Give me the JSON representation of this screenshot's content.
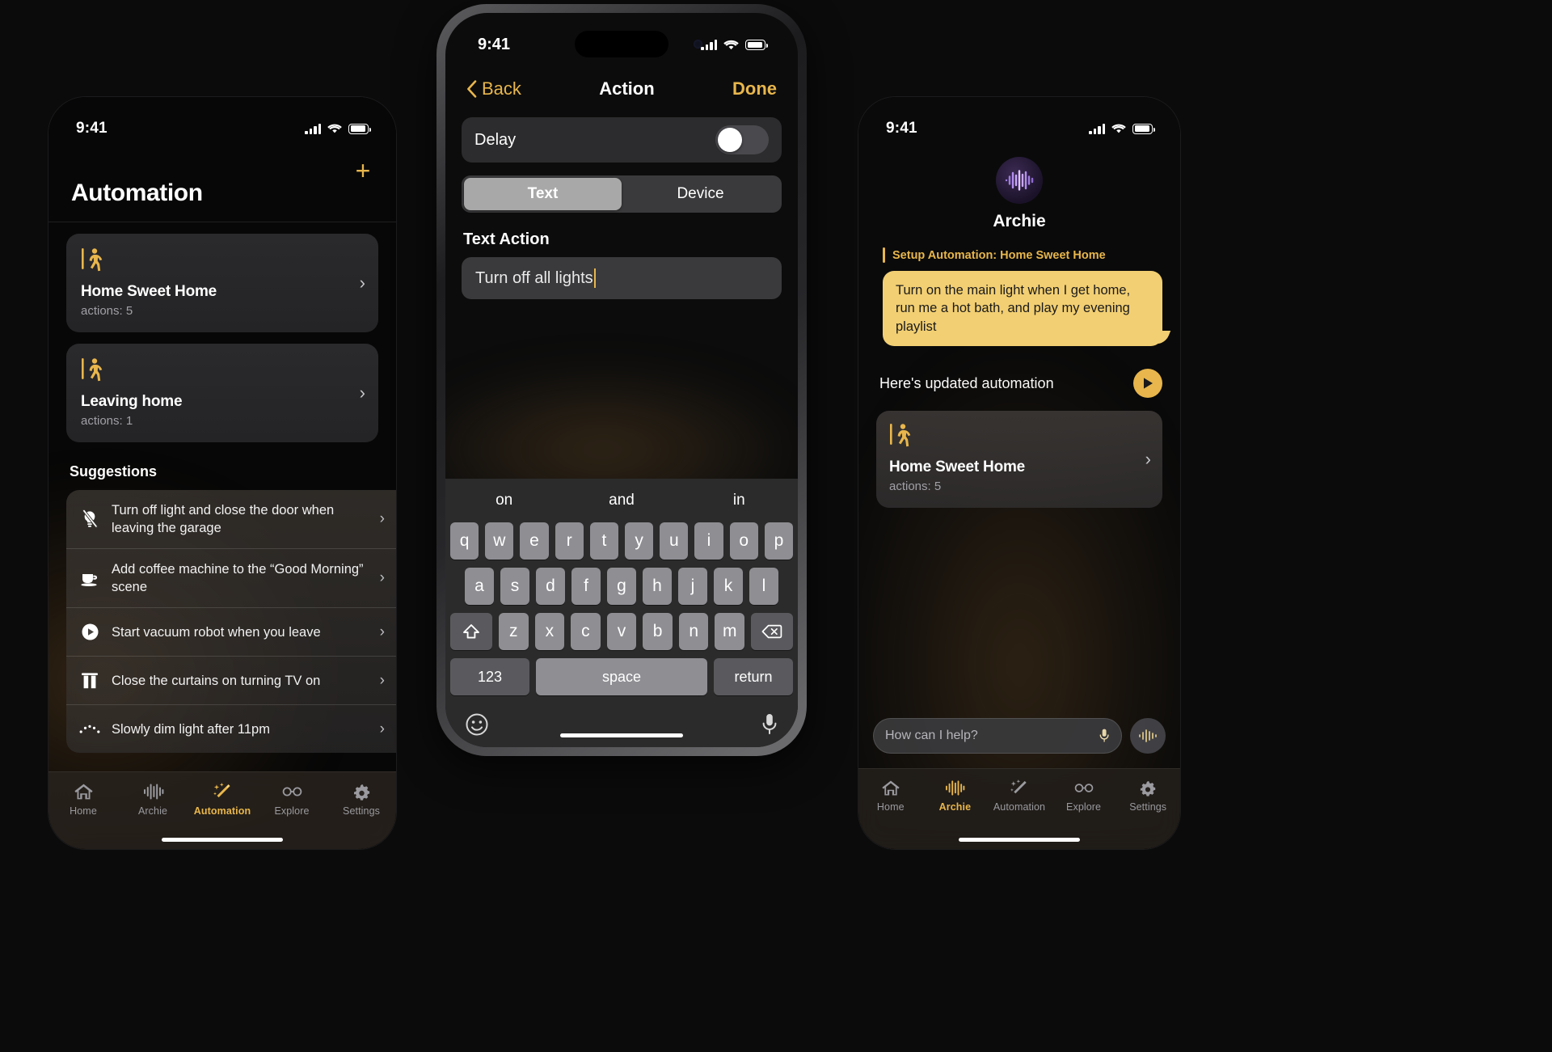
{
  "left_phone": {
    "status": {
      "time": "9:41",
      "cellular_icon": "cellular-bars-icon",
      "wifi_icon": "wifi-icon",
      "battery_icon": "battery-icon"
    },
    "add_label": "+",
    "title": "Automation",
    "automations": [
      {
        "icon": "person-walking-door-icon",
        "title": "Home Sweet Home",
        "subtitle": "actions: 5",
        "chevron": "›"
      },
      {
        "icon": "person-walking-door-icon",
        "title": "Leaving home",
        "subtitle": "actions: 1",
        "chevron": "›"
      }
    ],
    "suggestions_header": "Suggestions",
    "suggestions": [
      {
        "icon": "lightbulb-slash-icon",
        "text": "Turn off light and close the door when leaving the garage",
        "chevron": "›"
      },
      {
        "icon": "coffee-cup-icon",
        "text": "Add coffee machine to the “Good Morning” scene",
        "chevron": "›"
      },
      {
        "icon": "play-circle-icon",
        "text": "Start vacuum robot when you leave",
        "chevron": "›"
      },
      {
        "icon": "curtains-icon",
        "text": "Close the curtains on turning TV on",
        "chevron": "›"
      },
      {
        "icon": "dim-light-icon",
        "text": "Slowly dim light after 11pm",
        "chevron": "›"
      }
    ],
    "tabs": [
      {
        "label": "Home",
        "icon": "house-icon",
        "active": false
      },
      {
        "label": "Archie",
        "icon": "waveform-icon",
        "active": false
      },
      {
        "label": "Automation",
        "icon": "magic-wand-icon",
        "active": true
      },
      {
        "label": "Explore",
        "icon": "glasses-icon",
        "active": false
      },
      {
        "label": "Settings",
        "icon": "gear-icon",
        "active": false
      }
    ]
  },
  "center_phone": {
    "status": {
      "time": "9:41"
    },
    "nav": {
      "back": "Back",
      "title": "Action",
      "done": "Done"
    },
    "delay": {
      "label": "Delay",
      "value": "off"
    },
    "segments": [
      {
        "label": "Text",
        "active": true
      },
      {
        "label": "Device",
        "active": false
      }
    ],
    "section_label": "Text Action",
    "text_input": {
      "value": "Turn off all lights",
      "placeholder": ""
    },
    "keyboard": {
      "suggestions": [
        "on",
        "and",
        "in"
      ],
      "row1": [
        "q",
        "w",
        "e",
        "r",
        "t",
        "y",
        "u",
        "i",
        "o",
        "p"
      ],
      "row2": [
        "a",
        "s",
        "d",
        "f",
        "g",
        "h",
        "j",
        "k",
        "l"
      ],
      "row3": [
        "z",
        "x",
        "c",
        "v",
        "b",
        "n",
        "m"
      ],
      "shift_icon": "shift-up-icon",
      "backspace_icon": "backspace-icon",
      "numbers_key": "123",
      "space_key": "space",
      "return_key": "return",
      "emoji_icon": "emoji-smiley-icon",
      "mic_icon": "microphone-icon"
    }
  },
  "right_phone": {
    "status": {
      "time": "9:41"
    },
    "assistant": {
      "name": "Archie",
      "avatar_icon": "archie-waveform-avatar-icon"
    },
    "setup_label": "Setup Automation: Home Sweet Home",
    "bubble_text": "Turn on the main light when I get home, run me a hot bath, and play my evening playlist",
    "updated_label": "Here's updated automation",
    "play_icon": "play-triangle-icon",
    "automation_card": {
      "icon": "person-walking-door-icon",
      "title": "Home Sweet Home",
      "subtitle": "actions: 5",
      "chevron": "›"
    },
    "ask": {
      "placeholder": "How can I help?",
      "value": "",
      "mic_icon": "microphone-icon",
      "orb_icon": "siri-waveform-icon"
    },
    "tabs": [
      {
        "label": "Home",
        "icon": "house-icon",
        "active": false
      },
      {
        "label": "Archie",
        "icon": "waveform-icon",
        "active": true
      },
      {
        "label": "Automation",
        "icon": "magic-wand-icon",
        "active": false
      },
      {
        "label": "Explore",
        "icon": "glasses-icon",
        "active": false
      },
      {
        "label": "Settings",
        "icon": "gear-icon",
        "active": false
      }
    ]
  },
  "colors": {
    "accent_gold": "#e8b64c",
    "bubble": "#f2cf72",
    "card": "#2a2a2c",
    "background": "#0b0b0b"
  }
}
